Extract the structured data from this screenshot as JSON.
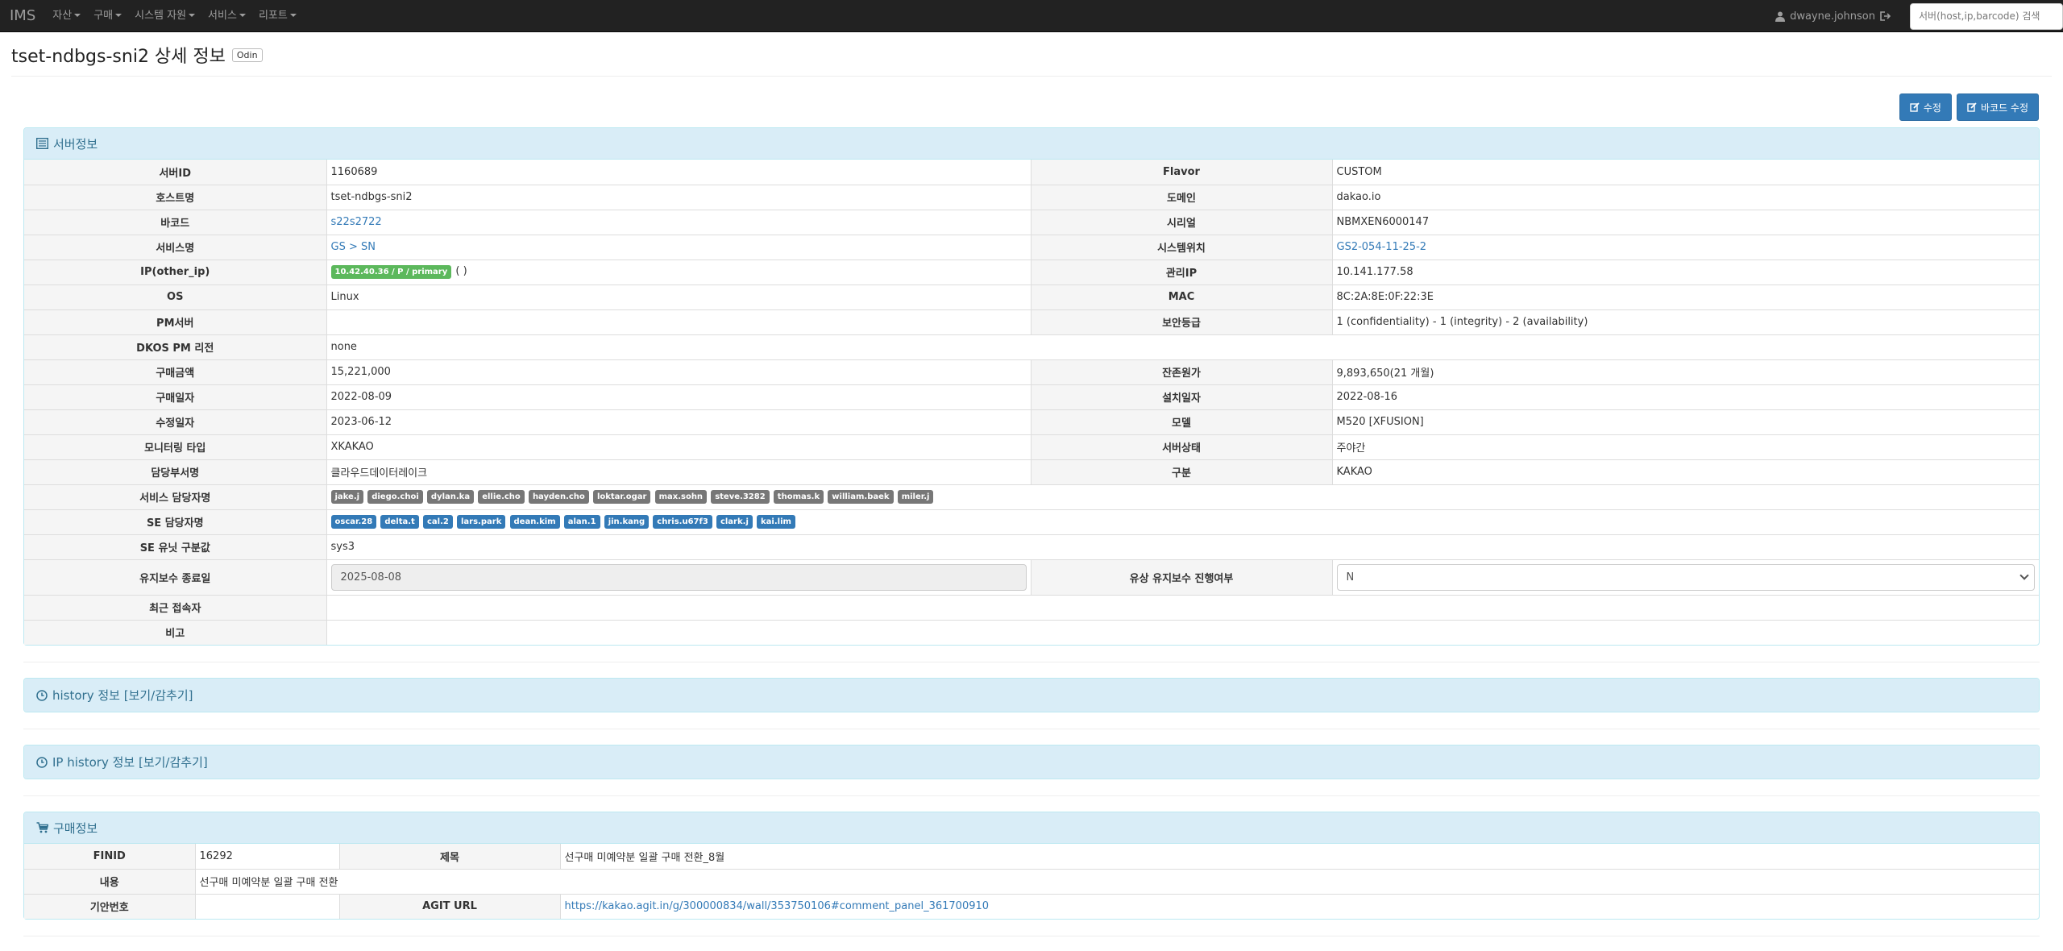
{
  "nav": {
    "brand": "IMS",
    "items": [
      {
        "label": "자산"
      },
      {
        "label": "구매"
      },
      {
        "label": "시스템 자원"
      },
      {
        "label": "서비스"
      },
      {
        "label": "리포트"
      }
    ],
    "user": "dwayne.johnson",
    "search_placeholder": "서버(host,ip,barcode) 검색"
  },
  "header": {
    "title": "tset-ndbgs-sni2 상세 정보",
    "badge": "Odin"
  },
  "actions": {
    "edit": "수정",
    "barcode_edit": "바코드 수정"
  },
  "server": {
    "heading": "서버정보",
    "server_id": {
      "label": "서버ID",
      "value": "1160689"
    },
    "flavor": {
      "label": "Flavor",
      "value": "CUSTOM"
    },
    "hostname": {
      "label": "호스트명",
      "value": "tset-ndbgs-sni2"
    },
    "domain": {
      "label": "도메인",
      "value": "dakao.io"
    },
    "barcode": {
      "label": "바코드",
      "value": "s22s2722"
    },
    "serial": {
      "label": "시리얼",
      "value": "NBMXEN6000147"
    },
    "service_name": {
      "label": "서비스명",
      "value": "GS > SN"
    },
    "system_location": {
      "label": "시스템위치",
      "value": "GS2-054-11-25-2"
    },
    "ip": {
      "label": "IP(other_ip)",
      "badge": "10.42.40.36 / P / primary",
      "other": "( )"
    },
    "mgmt_ip": {
      "label": "관리IP",
      "value": "10.141.177.58"
    },
    "os": {
      "label": "OS",
      "value": "Linux"
    },
    "mac": {
      "label": "MAC",
      "value": "8C:2A:8E:0F:22:3E"
    },
    "pm_server": {
      "label": "PM서버",
      "value": ""
    },
    "security_level": {
      "label": "보안등급",
      "value": "1 (confidentiality) - 1 (integrity) - 2 (availability)"
    },
    "dkos_pm_region": {
      "label": "DKOS PM 리전",
      "value": "none"
    },
    "purchase_amount": {
      "label": "구매금액",
      "value": "15,221,000"
    },
    "residual_value": {
      "label": "잔존원가",
      "value": "9,893,650(21 개월)"
    },
    "purchase_date": {
      "label": "구매일자",
      "value": "2022-08-09"
    },
    "install_date": {
      "label": "설치일자",
      "value": "2022-08-16"
    },
    "modified_date": {
      "label": "수정일자",
      "value": "2023-06-12"
    },
    "model": {
      "label": "모델",
      "value": "M520 [XFUSION]"
    },
    "monitoring_type": {
      "label": "모니터링 타입",
      "value": "XKAKAO"
    },
    "server_status": {
      "label": "서버상태",
      "value": "주야간"
    },
    "dept": {
      "label": "담당부서명",
      "value": "클라우드데이터레이크"
    },
    "category": {
      "label": "구분",
      "value": "KAKAO"
    },
    "service_managers": {
      "label": "서비스 담당자명",
      "items": [
        "jake.j",
        "diego.choi",
        "dylan.ka",
        "ellie.cho",
        "hayden.cho",
        "loktar.ogar",
        "max.sohn",
        "steve.3282",
        "thomas.k",
        "william.baek",
        "miler.j"
      ]
    },
    "se_managers": {
      "label": "SE 담당자명",
      "items": [
        "oscar.28",
        "delta.t",
        "cal.2",
        "lars.park",
        "dean.kim",
        "alan.1",
        "jin.kang",
        "chris.u67f3",
        "clark.j",
        "kai.lim"
      ]
    },
    "se_unit": {
      "label": "SE 유닛 구분값",
      "value": "sys3"
    },
    "maint_end": {
      "label": "유지보수 종료일",
      "value": "2025-08-08"
    },
    "paid_maint": {
      "label": "유상 유지보수 진행여부",
      "value": "N"
    },
    "recent_access": {
      "label": "최근 접속자",
      "value": ""
    },
    "remarks": {
      "label": "비고",
      "value": ""
    }
  },
  "history": {
    "heading": "history 정보 [보기/감추기]"
  },
  "ip_history": {
    "heading": "IP history 정보 [보기/감추기]"
  },
  "purchase": {
    "heading": "구매정보",
    "finid": {
      "label": "FINID",
      "value": "16292"
    },
    "subject": {
      "label": "제목",
      "value": "선구매 미예약분 일괄 구매 전환_8월"
    },
    "content": {
      "label": "내용",
      "value": "선구매 미예약분 일괄 구매 전환"
    },
    "draft_no": {
      "label": "기안번호",
      "value": ""
    },
    "agit_url": {
      "label": "AGIT URL",
      "value": "https://kakao.agit.in/g/300000834/wall/353750106#comment_panel_361700910"
    }
  },
  "colors": {
    "navbar": "#222222",
    "primary": "#337ab7",
    "panel_heading": "#d9edf7",
    "panel_border": "#bce8f1",
    "badge_green": "#5cb85c",
    "badge_gray": "#777777"
  }
}
